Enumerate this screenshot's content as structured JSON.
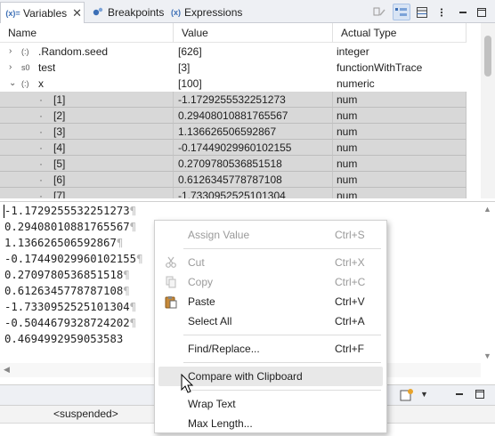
{
  "tabs": [
    {
      "label": "Variables",
      "icon": "variables-icon",
      "active": true,
      "closable": true
    },
    {
      "label": "Breakpoints",
      "icon": "breakpoints-icon",
      "active": false
    },
    {
      "label": "Expressions",
      "icon": "expressions-icon",
      "active": false
    }
  ],
  "tab_icon_glyphs": {
    "variables": "(x)=",
    "expressions": "(x)"
  },
  "toolbar_icons": [
    "collapse-all-icon",
    "show-type-names-icon",
    "layout-icon",
    "view-menu-icon",
    "minimize-icon",
    "maximize-icon"
  ],
  "columns": [
    "Name",
    "Value",
    "Actual Type"
  ],
  "variables": [
    {
      "expander": "›",
      "glyph": "(:)",
      "name": ".Random.seed",
      "value": "[626]",
      "type": "integer"
    },
    {
      "expander": "›",
      "glyph": "s0",
      "name": "test",
      "value": "[3]",
      "type": "functionWithTrace"
    },
    {
      "expander": "⌄",
      "glyph": "(:)",
      "name": "x",
      "value": "[100]",
      "type": "numeric"
    }
  ],
  "elements": [
    {
      "name": "[1]",
      "value": "-1.1729255532251273",
      "type": "num"
    },
    {
      "name": "[2]",
      "value": "0.29408010881765567",
      "type": "num"
    },
    {
      "name": "[3]",
      "value": "1.136626506592867",
      "type": "num"
    },
    {
      "name": "[4]",
      "value": "-0.17449029960102155",
      "type": "num"
    },
    {
      "name": "[5]",
      "value": "0.2709780536851518",
      "type": "num"
    },
    {
      "name": "[6]",
      "value": "0.6126345778787108",
      "type": "num"
    },
    {
      "name": "[7]",
      "value": "-1.7330952525101304",
      "type": "num"
    }
  ],
  "detail_lines": [
    {
      "text": "-1.1729255532251273",
      "mark": "¶"
    },
    {
      "text": "0.29408010881765567",
      "mark": "¶"
    },
    {
      "text": "1.136626506592867",
      "mark": "¶"
    },
    {
      "text": "-0.17449029960102155",
      "mark": "¶"
    },
    {
      "text": "0.2709780536851518",
      "mark": "¶"
    },
    {
      "text": "0.6126345778787108",
      "mark": "¶"
    },
    {
      "text": "-1.7330952525101304",
      "mark": "¶"
    },
    {
      "text": "-0.5044679328724202",
      "mark": "¶"
    },
    {
      "text": "0.4694992959053583",
      "mark": ""
    }
  ],
  "status": {
    "text": "<suspended>"
  },
  "context_menu": {
    "assign_value": {
      "label": "Assign Value",
      "shortcut": "Ctrl+S",
      "enabled": false
    },
    "cut": {
      "label": "Cut",
      "shortcut": "Ctrl+X",
      "enabled": false,
      "icon": "cut-icon"
    },
    "copy": {
      "label": "Copy",
      "shortcut": "Ctrl+C",
      "enabled": false,
      "icon": "copy-icon"
    },
    "paste": {
      "label": "Paste",
      "shortcut": "Ctrl+V",
      "enabled": true,
      "icon": "paste-icon"
    },
    "select_all": {
      "label": "Select All",
      "shortcut": "Ctrl+A",
      "enabled": true
    },
    "find_replace": {
      "label": "Find/Replace...",
      "shortcut": "Ctrl+F",
      "enabled": true
    },
    "compare_clipboard": {
      "label": "Compare with Clipboard",
      "enabled": true,
      "hovered": true
    },
    "wrap_text": {
      "label": "Wrap Text",
      "enabled": true
    },
    "max_length": {
      "label": "Max Length...",
      "enabled": true
    }
  },
  "colors": {
    "selected_row": "#d8d8d8",
    "accent_blue": "#3c6fb6",
    "disabled_text": "#9a9a9a"
  }
}
